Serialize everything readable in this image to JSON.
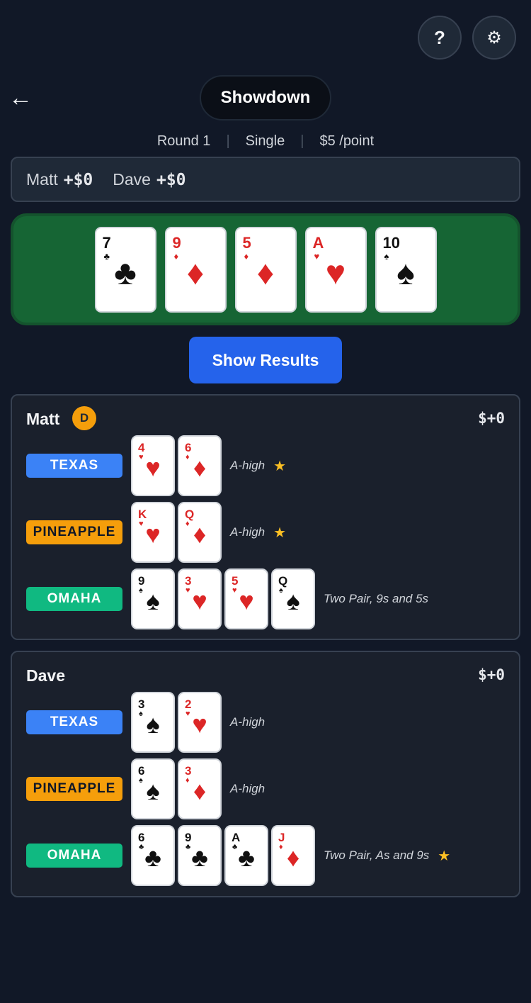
{
  "header": {
    "help_label": "?",
    "settings_label": "⚙",
    "back_label": "←",
    "title": "Showdown"
  },
  "meta": {
    "round": "Round 1",
    "mode": "Single",
    "stake": "$5 /point",
    "separator": "|"
  },
  "scoreboard": [
    {
      "name": "Matt",
      "amount": "+$0"
    },
    {
      "name": "Dave",
      "amount": "+$0"
    }
  ],
  "board": [
    {
      "rank": "7",
      "suit": "♣",
      "color": "black"
    },
    {
      "rank": "9",
      "suit": "♦",
      "color": "red"
    },
    {
      "rank": "5",
      "suit": "♦",
      "color": "red"
    },
    {
      "rank": "A",
      "suit": "♥",
      "color": "red"
    },
    {
      "rank": "10",
      "suit": "♠",
      "color": "black"
    }
  ],
  "show_results_label": "Show Results",
  "players": [
    {
      "name": "Matt",
      "dealer_badge": "D",
      "total": "$+0",
      "hands": [
        {
          "variant": "TEXAS",
          "cards": [
            {
              "rank": "4",
              "suit": "♥",
              "color": "red"
            },
            {
              "rank": "6",
              "suit": "♦",
              "color": "red"
            }
          ],
          "description": "A-high",
          "winner": true
        },
        {
          "variant": "PINEAPPLE",
          "cards": [
            {
              "rank": "K",
              "suit": "♥",
              "color": "red"
            },
            {
              "rank": "Q",
              "suit": "♦",
              "color": "red"
            }
          ],
          "description": "A-high",
          "winner": true
        },
        {
          "variant": "OMAHA",
          "cards": [
            {
              "rank": "9",
              "suit": "♠",
              "color": "black"
            },
            {
              "rank": "3",
              "suit": "♥",
              "color": "red"
            },
            {
              "rank": "5",
              "suit": "♥",
              "color": "red"
            },
            {
              "rank": "Q",
              "suit": "♠",
              "color": "black"
            }
          ],
          "description": "Two Pair, 9s and 5s",
          "winner": false
        }
      ]
    },
    {
      "name": "Dave",
      "dealer_badge": "",
      "total": "$+0",
      "hands": [
        {
          "variant": "TEXAS",
          "cards": [
            {
              "rank": "3",
              "suit": "♠",
              "color": "black"
            },
            {
              "rank": "2",
              "suit": "♥",
              "color": "red"
            }
          ],
          "description": "A-high",
          "winner": false
        },
        {
          "variant": "PINEAPPLE",
          "cards": [
            {
              "rank": "6",
              "suit": "♠",
              "color": "black"
            },
            {
              "rank": "3",
              "suit": "♦",
              "color": "red"
            }
          ],
          "description": "A-high",
          "winner": false
        },
        {
          "variant": "OMAHA",
          "cards": [
            {
              "rank": "6",
              "suit": "♣",
              "color": "black"
            },
            {
              "rank": "9",
              "suit": "♣",
              "color": "black"
            },
            {
              "rank": "A",
              "suit": "♣",
              "color": "black"
            },
            {
              "rank": "J",
              "suit": "♦",
              "color": "red"
            }
          ],
          "description": "Two Pair, As and 9s",
          "winner": true
        }
      ]
    }
  ],
  "star_glyph": "★",
  "colors": {
    "background": "#111827",
    "felt": "#166534",
    "primary": "#2563eb",
    "texas": "#3b82f6",
    "pineapple": "#f59e0b",
    "omaha": "#10b981",
    "star": "#fbbf24",
    "red_suit": "#dc2626"
  }
}
